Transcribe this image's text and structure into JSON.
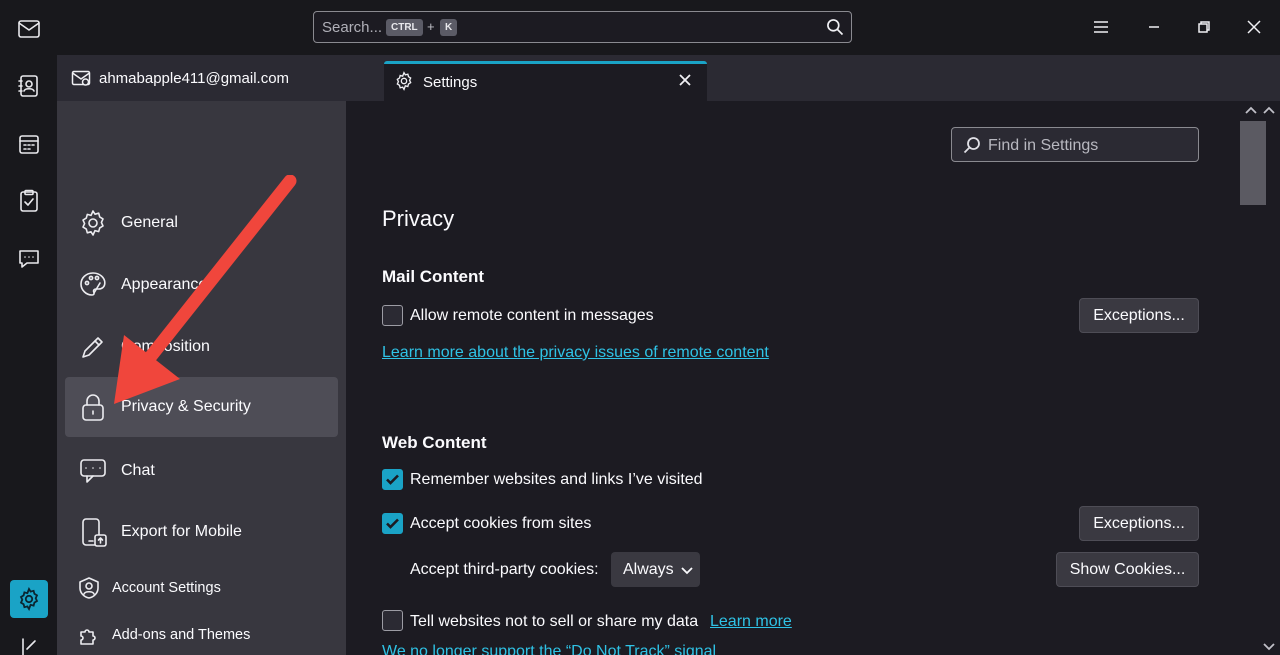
{
  "titlebar": {
    "search_placeholder": "Search...",
    "kbd_ctrl": "CTRL",
    "kbd_plus": "+",
    "kbd_k": "K"
  },
  "tabs": {
    "mail_tab_label": "ahmabapple411@gmail.com",
    "settings_tab_label": "Settings"
  },
  "sidebar": {
    "items": [
      {
        "label": "General",
        "icon": "gear-icon"
      },
      {
        "label": "Appearance",
        "icon": "palette-icon"
      },
      {
        "label": "Composition",
        "icon": "pencil-icon"
      },
      {
        "label": "Privacy & Security",
        "icon": "lock-icon",
        "selected": true
      },
      {
        "label": "Chat",
        "icon": "chat-icon"
      },
      {
        "label": "Export for Mobile",
        "icon": "mobile-export-icon"
      },
      {
        "label": "Account Settings",
        "icon": "account-icon"
      },
      {
        "label": "Add-ons and Themes",
        "icon": "puzzle-icon"
      }
    ]
  },
  "main": {
    "find_placeholder": "Find in Settings",
    "section_title": "Privacy",
    "mail_content": {
      "heading": "Mail Content",
      "allow_remote_label": "Allow remote content in messages",
      "allow_remote_checked": false,
      "exceptions_label": "Exceptions...",
      "learn_more_link": "Learn more about the privacy issues of remote content"
    },
    "web_content": {
      "heading": "Web Content",
      "remember_label": "Remember websites and links I’ve visited",
      "remember_checked": true,
      "accept_cookies_label": "Accept cookies from sites",
      "accept_cookies_checked": true,
      "exceptions_label": "Exceptions...",
      "third_party_label": "Accept third-party cookies:",
      "third_party_value": "Always",
      "show_cookies_label": "Show Cookies...",
      "dnt_label": "Tell websites not to sell or share my data",
      "dnt_checked": false,
      "dnt_learn_more": "Learn more",
      "dnt_notice": "We no longer support the “Do Not Track” signal"
    }
  },
  "colors": {
    "accent": "#1aa3c6",
    "link": "#2fc3e6",
    "annotation_arrow": "#f0463c"
  }
}
